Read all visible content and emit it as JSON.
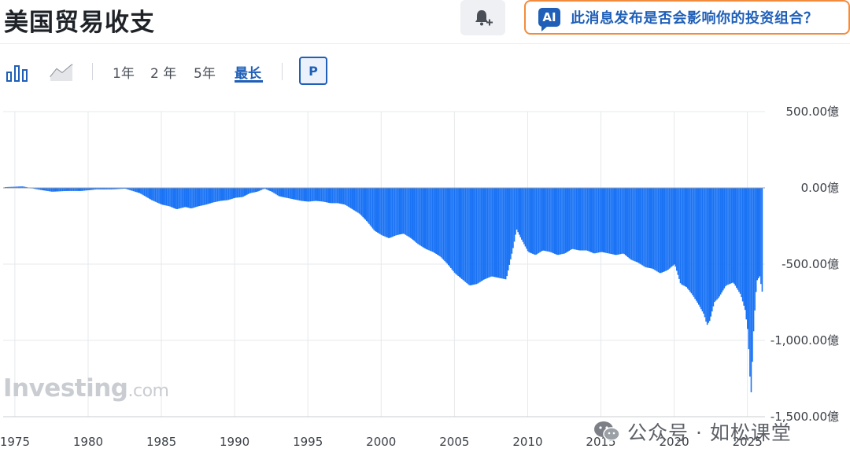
{
  "header": {
    "title": "美国贸易收支",
    "ai_badge": "AI",
    "ai_prompt": "此消息发布是否会影响你的投资组合？"
  },
  "toolbar": {
    "chart_types": [
      "bar-chart-icon",
      "line-chart-icon"
    ],
    "periods": [
      "1年",
      "2 年",
      "5年",
      "最长"
    ],
    "active_period": "最长",
    "p_button": "P"
  },
  "watermark": {
    "brand": "Investing",
    "brand_suffix": ".com",
    "wechat_text": "公众号 · 如松课堂"
  },
  "colors": {
    "bar": "#1a73f5",
    "accent": "#1f5fb8",
    "ai_border": "#f28c3c",
    "grid": "#e6e8eb"
  },
  "chart_data": {
    "type": "bar",
    "title": "",
    "xlabel": "",
    "ylabel": "",
    "unit": "億",
    "ylim": [
      -1500,
      500
    ],
    "yticks": [
      500,
      0,
      -500,
      -1000,
      -1500
    ],
    "ytick_labels": [
      "500.00億",
      "0.00億",
      "-500.00億",
      "-1,000.00億",
      "-1,500.00億"
    ],
    "xlim": [
      1974.2,
      2026.2
    ],
    "xticks": [
      1975,
      1980,
      1985,
      1990,
      1995,
      2000,
      2005,
      2010,
      2015,
      2020,
      2025
    ],
    "xtick_labels": [
      "1975",
      "1980",
      "1985",
      "1990",
      "1995",
      "2000",
      "2005",
      "2010",
      "2015",
      "2020",
      "2025"
    ],
    "series": [
      {
        "x": [
          1974.3,
          1975.5,
          1976.5,
          1977.5,
          1978.5,
          1979.5,
          1980.5,
          1981.5,
          1982.5,
          1983.5,
          1984.3,
          1985.0,
          1985.5,
          1986.0,
          1986.6,
          1987.0,
          1987.5,
          1988.0,
          1988.5,
          1989.0,
          1989.5,
          1990.0,
          1990.5,
          1991.0,
          1991.5,
          1992.0,
          1992.5,
          1993.0,
          1993.5,
          1994.0,
          1994.5,
          1995.0,
          1995.5,
          1996.0,
          1996.5,
          1997.0,
          1997.5,
          1998.0,
          1998.5,
          1999.0,
          1999.5,
          2000.0,
          2000.5,
          2001.0,
          2001.5,
          2002.0,
          2002.5,
          2003.0,
          2003.5,
          2004.0,
          2004.5,
          2005.0,
          2005.5,
          2006.0,
          2006.5,
          2007.0,
          2007.5,
          2008.0,
          2008.5,
          2009.0,
          2009.2,
          2009.5,
          2010.0,
          2010.5,
          2011.0,
          2011.5,
          2012.0,
          2012.5,
          2013.0,
          2013.5,
          2014.0,
          2014.5,
          2015.0,
          2015.5,
          2016.0,
          2016.5,
          2017.0,
          2017.5,
          2018.0,
          2018.5,
          2019.0,
          2019.5,
          2020.0,
          2020.4,
          2020.8,
          2021.2,
          2021.6,
          2022.0,
          2022.2,
          2022.4,
          2022.7,
          2023.0,
          2023.5,
          2024.0,
          2024.5,
          2024.8,
          2025.0,
          2025.2,
          2025.4,
          2025.6,
          2025.8,
          2026.0
        ],
        "values": [
          5,
          10,
          -10,
          -25,
          -20,
          -20,
          -10,
          -10,
          -5,
          -35,
          -80,
          -110,
          -120,
          -140,
          -125,
          -135,
          -120,
          -110,
          -95,
          -85,
          -80,
          -65,
          -60,
          -35,
          -25,
          -5,
          -25,
          -55,
          -65,
          -75,
          -85,
          -90,
          -85,
          -90,
          -100,
          -100,
          -110,
          -140,
          -170,
          -220,
          -280,
          -310,
          -330,
          -310,
          -300,
          -330,
          -370,
          -400,
          -420,
          -450,
          -500,
          -560,
          -600,
          -640,
          -630,
          -600,
          -580,
          -590,
          -600,
          -380,
          -270,
          -330,
          -420,
          -440,
          -410,
          -420,
          -440,
          -430,
          -400,
          -410,
          -410,
          -430,
          -420,
          -430,
          -440,
          -430,
          -470,
          -490,
          -520,
          -530,
          -560,
          -540,
          -500,
          -630,
          -650,
          -700,
          -760,
          -830,
          -900,
          -870,
          -750,
          -720,
          -640,
          -620,
          -700,
          -800,
          -950,
          -1380,
          -900,
          -610,
          -580,
          -700
        ]
      }
    ]
  }
}
